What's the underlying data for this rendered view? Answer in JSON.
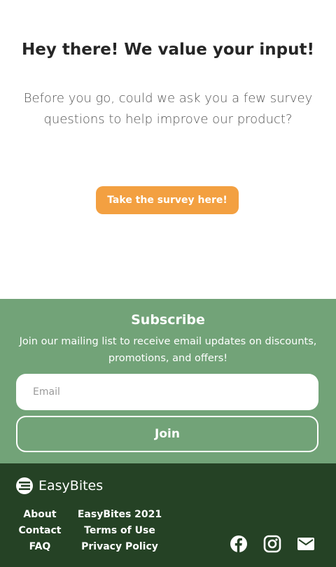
{
  "survey": {
    "heading": "Hey there! We value your input!",
    "body": "Before you go, could we ask you a few survey questions to help improve our product?",
    "button_label": "Take the survey here!"
  },
  "subscribe": {
    "heading": "Subscribe",
    "body": "Join our mailing list to receive email updates on discounts, promotions, and offers!",
    "email_placeholder": "Email",
    "join_label": "Join"
  },
  "footer": {
    "brand": "EasyBites",
    "links_col1": [
      "About",
      "Contact",
      "FAQ"
    ],
    "links_col2": [
      "EasyBites 2021",
      "Terms of Use",
      "Privacy Policy"
    ],
    "social_icons": [
      "facebook-icon",
      "instagram-icon",
      "mail-icon"
    ]
  },
  "colors": {
    "accent": "#f3a041",
    "subscribe_bg": "#72a378",
    "footer_bg": "#254225"
  }
}
